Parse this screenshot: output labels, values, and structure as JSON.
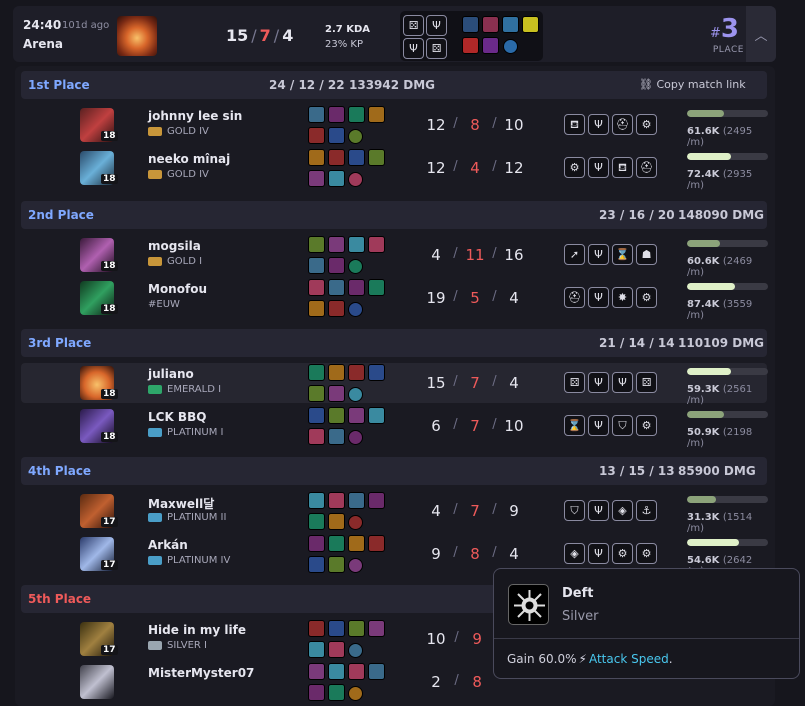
{
  "header": {
    "time": "24:40",
    "ago": "101d ago",
    "mode": "Arena",
    "kills": "15",
    "deaths": "7",
    "assists": "4",
    "kda_ratio": "2.7 KDA",
    "kp": "23% KP",
    "place_hash": "#",
    "place_num": "3",
    "place_label": "PLACE"
  },
  "groups": [
    {
      "place": "1st Place",
      "color": "#7fa8ff",
      "kda": "24 / 12 / 22",
      "dmg": "133942 DMG",
      "copy_link": "Copy match link",
      "players": [
        {
          "name": "johnny lee sin",
          "level": "18",
          "rank": "GOLD IV",
          "rank_color": "#c8963a",
          "k": "12",
          "d": "8",
          "a": "10",
          "dmg": "61.6K",
          "pm": "(2495 /m)",
          "dmg_frac": 0.46,
          "bar_color": "#8ca37a",
          "augs": [
            "cauldron",
            "spikes",
            "helm",
            "gear"
          ]
        },
        {
          "name": "neeko mînaj",
          "level": "18",
          "rank": "GOLD IV",
          "rank_color": "#c8963a",
          "k": "12",
          "d": "4",
          "a": "12",
          "dmg": "72.4K",
          "pm": "(2935 /m)",
          "dmg_frac": 0.54,
          "bar_color": "#dff0c8",
          "augs": [
            "gear",
            "spikes",
            "cauldron",
            "helm"
          ]
        }
      ]
    },
    {
      "place": "2nd Place",
      "color": "#7fa8ff",
      "kda": "23 / 16 / 20",
      "dmg": "148090 DMG",
      "players": [
        {
          "name": "mogsila",
          "level": "18",
          "rank": "GOLD I",
          "rank_color": "#c8963a",
          "k": "4",
          "d": "11",
          "a": "16",
          "dmg": "60.6K",
          "pm": "(2469 /m)",
          "dmg_frac": 0.41,
          "bar_color": "#8ca37a",
          "augs": [
            "arrow",
            "spikes",
            "hourglass",
            "bear"
          ]
        },
        {
          "name": "Monofou",
          "level": "18",
          "rank": "#EUW",
          "rank_color": "",
          "k": "19",
          "d": "5",
          "a": "4",
          "dmg": "87.4K",
          "pm": "(3559 /m)",
          "dmg_frac": 0.59,
          "bar_color": "#dff0c8",
          "augs": [
            "helm",
            "spikes",
            "burst",
            "gear"
          ]
        }
      ]
    },
    {
      "place": "3rd Place",
      "color": "#7fa8ff",
      "kda": "21 / 14 / 14",
      "dmg": "110109 DMG",
      "players": [
        {
          "name": "juliano",
          "level": "18",
          "rank": "EMERALD I",
          "rank_color": "#2ea66a",
          "k": "15",
          "d": "7",
          "a": "4",
          "dmg": "59.3K",
          "pm": "(2561 /m)",
          "dmg_frac": 0.54,
          "bar_color": "#dff0c8",
          "augs": [
            "dice",
            "spikes",
            "spikes",
            "dice"
          ],
          "highlight": true
        },
        {
          "name": "LCK BBQ",
          "level": "18",
          "rank": "PLATINUM I",
          "rank_color": "#4a9ec8",
          "k": "6",
          "d": "7",
          "a": "10",
          "dmg": "50.9K",
          "pm": "(2198 /m)",
          "dmg_frac": 0.46,
          "bar_color": "#8ca37a",
          "augs": [
            "hourglass",
            "spikes",
            "shield",
            "gear"
          ]
        }
      ]
    },
    {
      "place": "4th Place",
      "color": "#7fa8ff",
      "kda": "13 / 15 / 13",
      "dmg": "85900 DMG",
      "players": [
        {
          "name": "Maxwell달",
          "level": "17",
          "rank": "PLATINUM II",
          "rank_color": "#4a9ec8",
          "k": "4",
          "d": "7",
          "a": "9",
          "dmg": "31.3K",
          "pm": "(1514 /m)",
          "dmg_frac": 0.36,
          "bar_color": "#8ca37a",
          "augs": [
            "shield",
            "spikes",
            "diamond",
            "anchor"
          ]
        },
        {
          "name": "Arkán",
          "level": "17",
          "rank": "PLATINUM IV",
          "rank_color": "#4a9ec8",
          "k": "9",
          "d": "8",
          "a": "4",
          "dmg": "54.6K",
          "pm": "(2642 /m)",
          "dmg_frac": 0.64,
          "bar_color": "#dff0c8",
          "augs": [
            "diamond",
            "spikes",
            "gear",
            "gear"
          ]
        }
      ]
    },
    {
      "place": "5th Place",
      "color": "#ef5a5a",
      "kda": "",
      "dmg": "",
      "players": [
        {
          "name": "Hide in my life",
          "level": "17",
          "rank": "SILVER I",
          "rank_color": "#9aa6b0",
          "k": "10",
          "d": "9",
          "a": "",
          "dmg": "",
          "pm": "",
          "dmg_frac": 0,
          "bar_color": "#8ca37a",
          "augs": []
        },
        {
          "name": "MisterMyster07",
          "level": "",
          "rank": "",
          "rank_color": "#9aa6b0",
          "k": "2",
          "d": "8",
          "a": "",
          "dmg": "",
          "pm": "",
          "dmg_frac": 0,
          "bar_color": "#8ca37a",
          "augs": []
        }
      ]
    }
  ],
  "tooltip": {
    "title": "Deft",
    "subtitle": "Silver",
    "gain_prefix": "Gain 60.0%",
    "stat": "Attack Speed",
    "suffix": "."
  }
}
